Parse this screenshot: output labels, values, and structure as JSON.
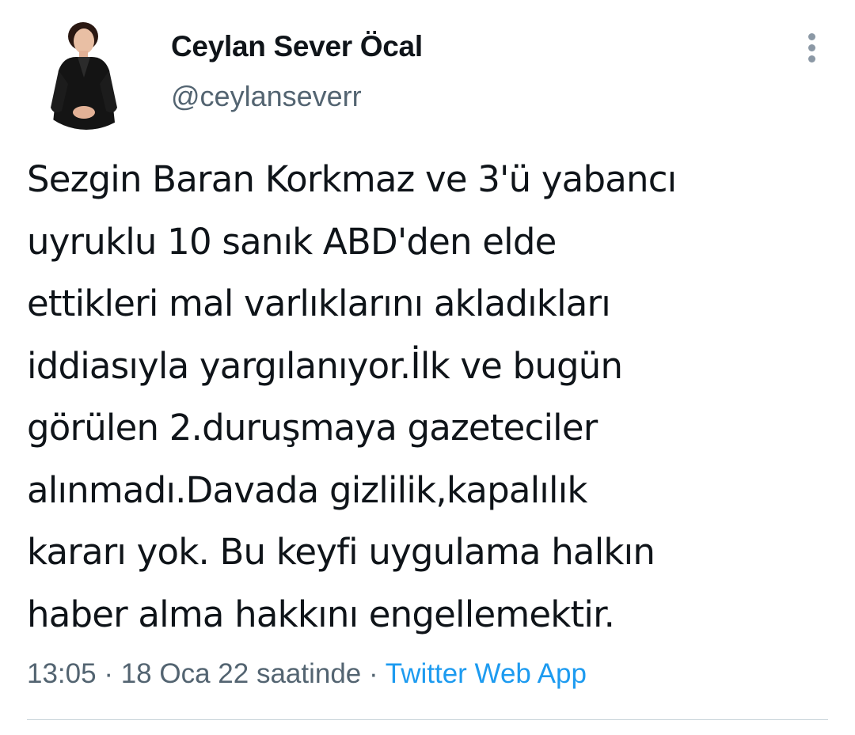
{
  "author": {
    "display_name": "Ceylan Sever Öcal",
    "handle": "@ceylanseverr"
  },
  "tweet": {
    "text": "Sezgin Baran Korkmaz ve 3'ü yabancı\nuyruklu 10 sanık ABD'den elde\nettikleri mal varlıklarını akladıkları\niddiasıyla yargılanıyor.İlk ve bugün\ngörülen 2.duruşmaya gazeteciler\nalınmadı.Davada gizlilik,kapalılık\nkararı yok. Bu keyfi uygulama halkın\nhaber alma hakkını engellemektir.",
    "time": "13:05",
    "separator": "·",
    "date": "18 Oca 22 saatinde",
    "source": "Twitter Web App"
  },
  "icons": {
    "more": "more-vertical-icon"
  },
  "colors": {
    "text": "#0f1419",
    "secondary": "#536471",
    "link": "#1d9bf0",
    "divider": "#cfd9de"
  }
}
